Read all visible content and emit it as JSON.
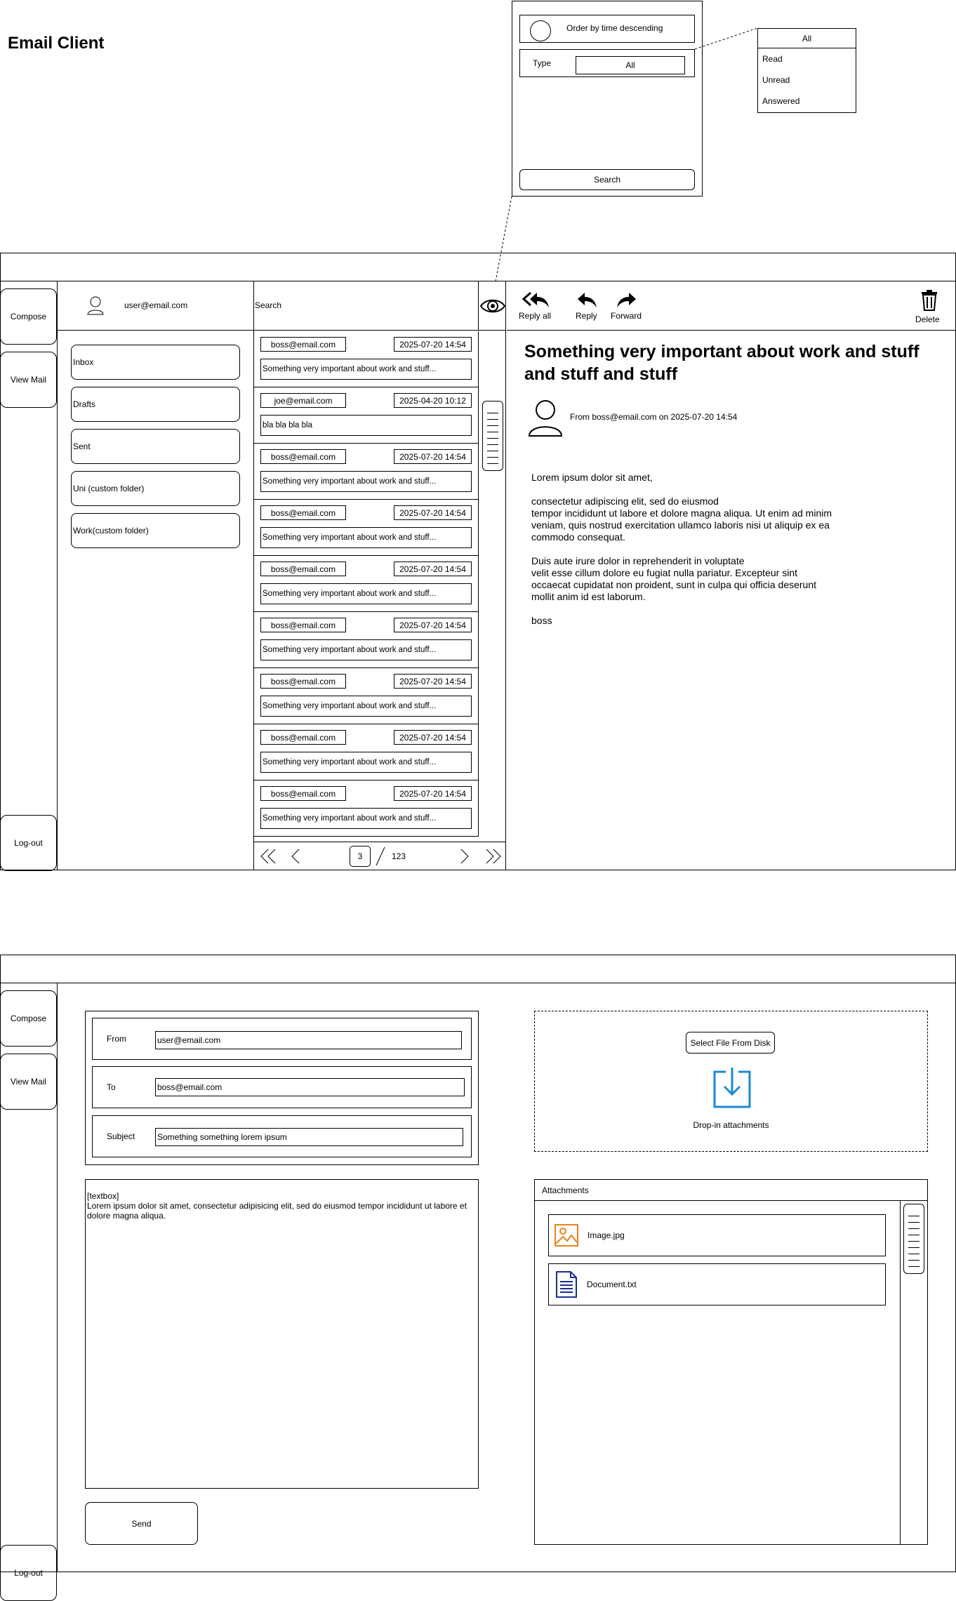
{
  "app_title": "Email Client",
  "filter_popup": {
    "order_label": "Order by time descending",
    "type_label": "Type",
    "type_value": "All",
    "search_button": "Search"
  },
  "type_dropdown": {
    "selected": "All",
    "options": [
      "Read",
      "Unread",
      "Answered"
    ]
  },
  "sidebar": {
    "compose": "Compose",
    "view_mail": "View Mail",
    "logout": "Log-out"
  },
  "account": {
    "email": "user@email.com"
  },
  "folders": [
    "Inbox",
    "Drafts",
    "Sent",
    "Uni (custom folder)",
    "Work(custom folder)"
  ],
  "search": {
    "label": "Search"
  },
  "emails": [
    {
      "from": "boss@email.com",
      "date": "2025-07-20 14:54",
      "subject": "Something very important about work and stuff..."
    },
    {
      "from": "joe@email.com",
      "date": "2025-04-20 10:12",
      "subject": "bla bla bla bla"
    },
    {
      "from": "boss@email.com",
      "date": "2025-07-20 14:54",
      "subject": "Something very important about work and stuff..."
    },
    {
      "from": "boss@email.com",
      "date": "2025-07-20 14:54",
      "subject": "Something very important about work and stuff..."
    },
    {
      "from": "boss@email.com",
      "date": "2025-07-20 14:54",
      "subject": "Something very important about work and stuff..."
    },
    {
      "from": "boss@email.com",
      "date": "2025-07-20 14:54",
      "subject": "Something very important about work and stuff..."
    },
    {
      "from": "boss@email.com",
      "date": "2025-07-20 14:54",
      "subject": "Something very important about work and stuff..."
    },
    {
      "from": "boss@email.com",
      "date": "2025-07-20 14:54",
      "subject": "Something very important about work and stuff..."
    },
    {
      "from": "boss@email.com",
      "date": "2025-07-20 14:54",
      "subject": "Something very important about work and stuff..."
    }
  ],
  "pagination": {
    "current": "3",
    "total": "123"
  },
  "toolbar": {
    "reply_all": "Reply all",
    "reply": "Reply",
    "forward": "Forward",
    "delete": "Delete"
  },
  "reader": {
    "subject": "Something very important about work and stuff and stuff and stuff",
    "from_line": "From boss@email.com on 2025-07-20 14:54",
    "body": [
      "Lorem ipsum dolor sit amet,",
      "consectetur adipiscing elit, sed do eiusmod\ntempor incididunt ut labore et dolore magna aliqua. Ut enim ad minim\nveniam, quis nostrud exercitation ullamco laboris nisi ut aliquip ex ea\ncommodo consequat.",
      "Duis aute irure dolor in reprehenderit in voluptate\nvelit esse cillum dolore eu fugiat nulla pariatur. Excepteur sint\noccaecat cupidatat non proident, sunt in culpa qui officia deserunt\nmollit anim id est laborum.",
      "boss"
    ]
  },
  "compose": {
    "from_label": "From",
    "from_value": "user@email.com",
    "to_label": "To",
    "to_value": "boss@email.com",
    "subject_label": "Subject",
    "subject_value": "Something something lorem ipsum",
    "body_text": "[textbox]\nLorem ipsum dolor sit amet, consectetur adipisicing elit, sed do eiusmod tempor incididunt ut labore et dolore magna aliqua.",
    "send_button": "Send",
    "select_file_button": "Select File From Disk",
    "drop_label": "Drop-in attachments",
    "attachments_header": "Attachments",
    "attachments": [
      {
        "name": "Image.jpg",
        "icon": "image-icon",
        "color": "#e8821e"
      },
      {
        "name": "Document.txt",
        "icon": "document-icon",
        "color": "#1a2f8a"
      }
    ]
  },
  "colors": {
    "accent_blue": "#1a8ad4"
  }
}
